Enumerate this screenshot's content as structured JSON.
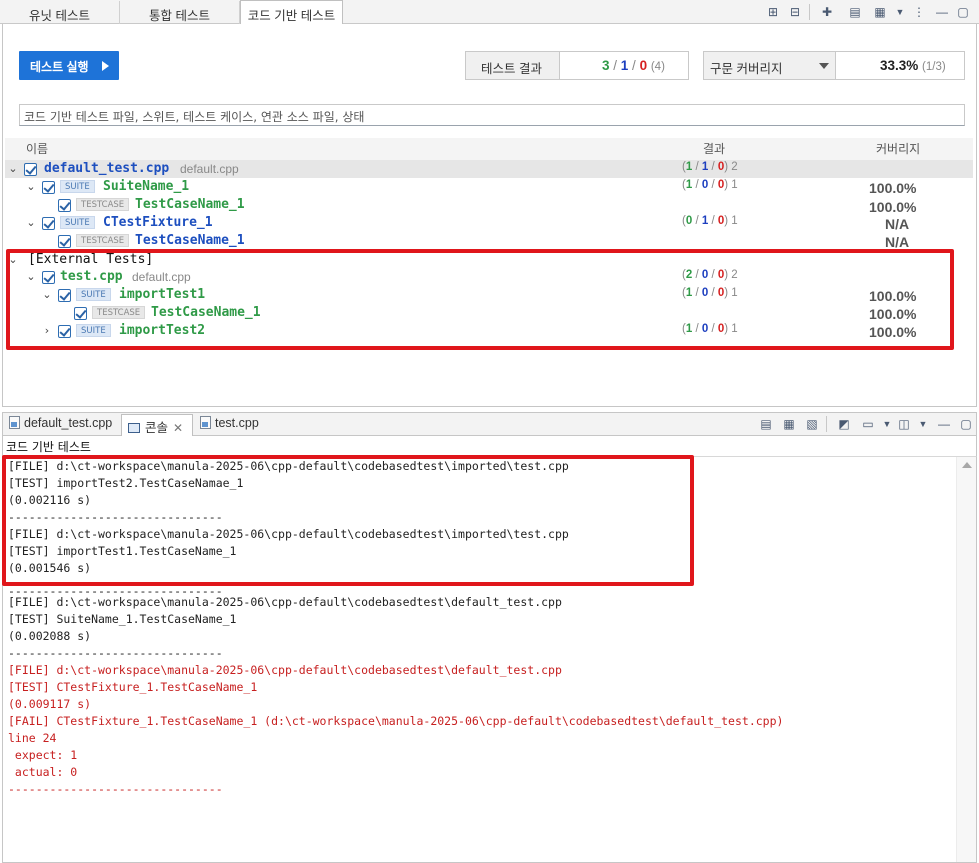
{
  "tabs": [
    {
      "label": "유닛 테스트"
    },
    {
      "label": "통합 테스트"
    },
    {
      "label": "코드 기반 테스트",
      "active": true
    }
  ],
  "toolbar_icons": [
    "expand-all-icon",
    "collapse-all-icon",
    "new-test-icon",
    "import-icon",
    "export-icon",
    "dropdown-icon",
    "view-menu-icon",
    "minimize-icon",
    "maximize-icon"
  ],
  "run_button": {
    "label": "테스트 실행"
  },
  "results": {
    "label": "테스트 결과",
    "pass": "3",
    "sep1": " / ",
    "error": "1",
    "sep2": " / ",
    "fail": "0",
    "total": "(4)"
  },
  "coverage": {
    "select_label": "구문 커버리지",
    "value": "33.3%",
    "detail": "(1/3)"
  },
  "filter": {
    "placeholder": "코드 기반 테스트 파일, 스위트, 테스트 케이스, 연관 소스 파일, 상태"
  },
  "columns": {
    "name": "이름",
    "result": "결과",
    "coverage": "커버리지"
  },
  "tree": {
    "default_file": {
      "name": "default_test.cpp",
      "sub": "default.cpp",
      "pass": "1",
      "error": "1",
      "fail": "0",
      "total": "2"
    },
    "suite1": {
      "badge": "SUITE",
      "name": "SuiteName_1",
      "pass": "1",
      "error": "0",
      "fail": "0",
      "total": "1",
      "coverage": "100.0%"
    },
    "suite1_case": {
      "badge": "TESTCASE",
      "name": "TestCaseName_1",
      "coverage": "100.0%"
    },
    "fixture": {
      "badge": "SUITE",
      "name": "CTestFixture_1",
      "pass": "0",
      "error": "1",
      "fail": "0",
      "total": "1",
      "coverage": "N/A"
    },
    "fixture_case": {
      "badge": "TESTCASE",
      "name": "TestCaseName_1",
      "coverage": "N/A"
    },
    "external": {
      "name": "[External Tests]"
    },
    "test_file": {
      "name": "test.cpp",
      "sub": "default.cpp",
      "pass": "2",
      "error": "0",
      "fail": "0",
      "total": "2"
    },
    "import1": {
      "badge": "SUITE",
      "name": "importTest1",
      "pass": "1",
      "error": "0",
      "fail": "0",
      "total": "1",
      "coverage": "100.0%"
    },
    "import1_case": {
      "badge": "TESTCASE",
      "name": "TestCaseName_1",
      "coverage": "100.0%"
    },
    "import2": {
      "badge": "SUITE",
      "name": "importTest2",
      "pass": "1",
      "error": "0",
      "fail": "0",
      "total": "1",
      "coverage": "100.0%"
    }
  },
  "console": {
    "tabs": [
      {
        "label": "default_test.cpp",
        "icon": "file-icon"
      },
      {
        "label": "콘솔",
        "icon": "console-icon",
        "active": true
      },
      {
        "label": "test.cpp",
        "icon": "file-icon"
      }
    ],
    "title": "코드 기반 테스트",
    "lines": [
      {
        "text": "[FILE] d:\\ct-workspace\\manula-2025-06\\cpp-default\\codebasedtest\\imported\\test.cpp",
        "color": "#222222"
      },
      {
        "text": "[TEST] importTest2.TestCaseNamae_1",
        "color": "#222222"
      },
      {
        "text": "(0.002116 s)",
        "color": "#222222"
      },
      {
        "text": "-------------------------------",
        "color": "#222222"
      },
      {
        "text": "[FILE] d:\\ct-workspace\\manula-2025-06\\cpp-default\\codebasedtest\\imported\\test.cpp",
        "color": "#222222"
      },
      {
        "text": "[TEST] importTest1.TestCaseName_1",
        "color": "#222222"
      },
      {
        "text": "(0.001546 s)",
        "color": "#222222"
      },
      {
        "text": "-------------------------------",
        "color": "#222222"
      },
      {
        "text": "[FILE] d:\\ct-workspace\\manula-2025-06\\cpp-default\\codebasedtest\\default_test.cpp",
        "color": "#222222"
      },
      {
        "text": "[TEST] SuiteName_1.TestCaseName_1",
        "color": "#222222"
      },
      {
        "text": "(0.002088 s)",
        "color": "#222222"
      },
      {
        "text": "-------------------------------",
        "color": "#222222"
      },
      {
        "text": "[FILE] d:\\ct-workspace\\manula-2025-06\\cpp-default\\codebasedtest\\default_test.cpp",
        "color": "#c72020"
      },
      {
        "text": "[TEST] CTestFixture_1.TestCaseName_1",
        "color": "#c72020"
      },
      {
        "text": "(0.009117 s)",
        "color": "#c72020"
      },
      {
        "text": "[FAIL] CTestFixture_1.TestCaseName_1 (d:\\ct-workspace\\manula-2025-06\\cpp-default\\codebasedtest\\default_test.cpp)",
        "color": "#c72020"
      },
      {
        "text": "line 24",
        "color": "#c72020"
      },
      {
        "text": " expect: 1",
        "color": "#c72020"
      },
      {
        "text": " actual: 0",
        "color": "#c72020"
      },
      {
        "text": "-------------------------------",
        "color": "#c72020"
      }
    ]
  },
  "colors": {
    "accent": "#1e73d8",
    "pass": "#2f9a47",
    "error": "#1d3fbf",
    "fail": "#d62020",
    "highlight": "#e0161b"
  }
}
